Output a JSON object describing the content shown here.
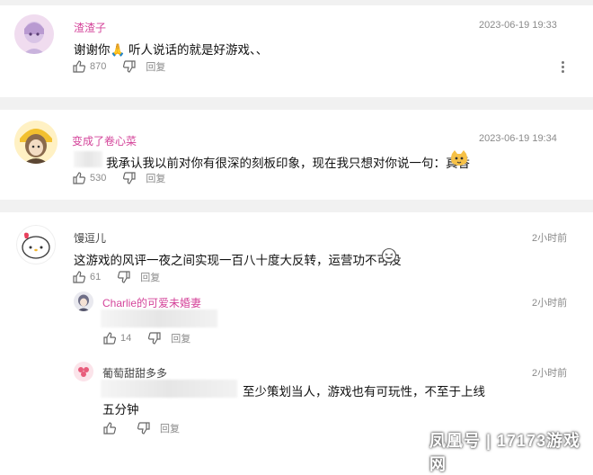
{
  "comments": [
    {
      "username": "渣渣子",
      "timestamp": "2023-06-19 19:33",
      "text": "谢谢你🙏 听人说话的就是好游戏、、",
      "likes": "870",
      "reply_label": "回复",
      "name_color": "#d4449a"
    },
    {
      "username": "变成了卷心菜",
      "timestamp": "2023-06-19 19:34",
      "text": "我承认我以前对你有很深的刻板印象，现在我只想对你说一句：真香",
      "likes": "530",
      "reply_label": "回复",
      "name_color": "#d4449a"
    },
    {
      "username": "馒逗儿",
      "timestamp": "2小时前",
      "text": "这游戏的风评一夜之间实现一百八十度大反转，运营功不可没",
      "likes": "61",
      "reply_label": "回复",
      "name_color": "#444444",
      "replies": [
        {
          "username": "Charlie的可爱未婚妻",
          "timestamp": "2小时前",
          "likes": "14",
          "reply_label": "回复",
          "name_color": "#d4449a"
        },
        {
          "username": "葡萄甜甜多多",
          "timestamp": "2小时前",
          "text_line1": "至少策划当人，游戏也有可玩性，不至于上线",
          "text_line2": "五分钟",
          "likes": "",
          "reply_label": "回复",
          "name_color": "#444444"
        }
      ]
    }
  ],
  "watermark": "凤凰号 | 17173游戏网",
  "icons": [
    "thumbs-up-icon",
    "thumbs-down-icon",
    "more-vertical-icon"
  ]
}
